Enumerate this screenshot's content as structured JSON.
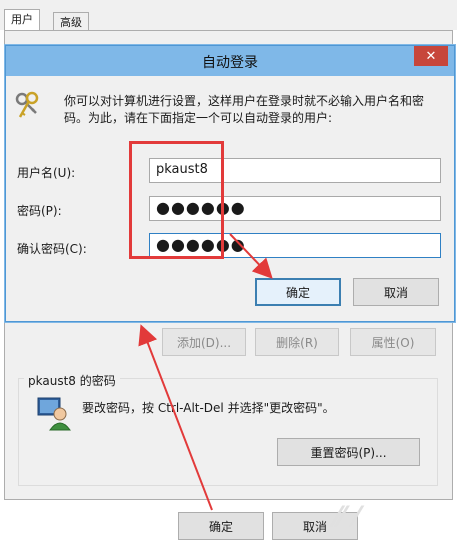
{
  "background_window": {
    "tabs": [
      {
        "label": "用户"
      },
      {
        "label": "高级"
      }
    ],
    "buttons": {
      "add": "添加(D)...",
      "remove": "删除(R)",
      "properties": "属性(O)"
    },
    "password_group": {
      "title": "pkaust8 的密码",
      "hint": "要改密码，按 Ctrl-Alt-Del 并选择\"更改密码\"。",
      "reset_button": "重置密码(P)..."
    },
    "footer": {
      "ok": "确定",
      "cancel": "取消"
    }
  },
  "dialog": {
    "title": "自动登录",
    "close_icon": "close-icon",
    "description": "你可以对计算机进行设置，这样用户在登录时就不必输入用户名和密码。为此，请在下面指定一个可以自动登录的用户:",
    "fields": {
      "username": {
        "label": "用户名(U):",
        "value": "pkaust8"
      },
      "password": {
        "label": "密码(P):",
        "value": "●●●●●●"
      },
      "confirm": {
        "label": "确认密码(C):",
        "value": "●●●●●●"
      }
    },
    "buttons": {
      "ok": "确定",
      "cancel": "取消"
    }
  },
  "annotation_color": "#e23a3a",
  "accent_color": "#7fb8e8"
}
